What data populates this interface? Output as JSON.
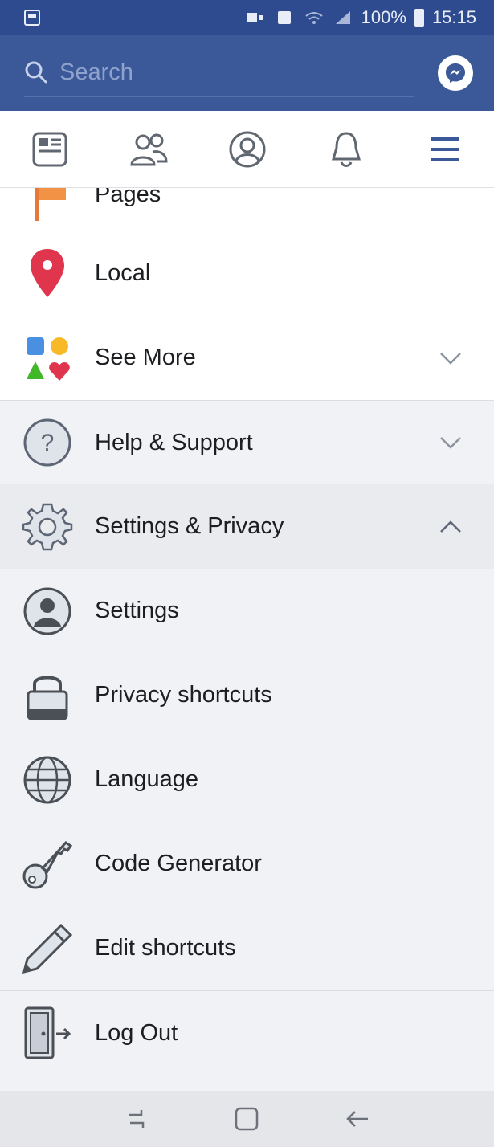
{
  "status_bar": {
    "battery": "100%",
    "time": "15:15"
  },
  "search": {
    "placeholder": "Search"
  },
  "tabs": [
    {
      "icon": "news-feed-icon"
    },
    {
      "icon": "friends-icon"
    },
    {
      "icon": "profile-icon"
    },
    {
      "icon": "notifications-icon"
    },
    {
      "icon": "menu-icon"
    }
  ],
  "menu": {
    "pages_label": "Pages",
    "local_label": "Local",
    "see_more_label": "See More",
    "help_support_label": "Help & Support",
    "settings_privacy_label": "Settings & Privacy",
    "settings_label": "Settings",
    "privacy_shortcuts_label": "Privacy shortcuts",
    "language_label": "Language",
    "code_generator_label": "Code Generator",
    "edit_shortcuts_label": "Edit shortcuts",
    "log_out_label": "Log Out"
  },
  "colors": {
    "brand_blue": "#3b5998",
    "status_bar": "#2f4b8f",
    "local_pin": "#e0364d"
  }
}
